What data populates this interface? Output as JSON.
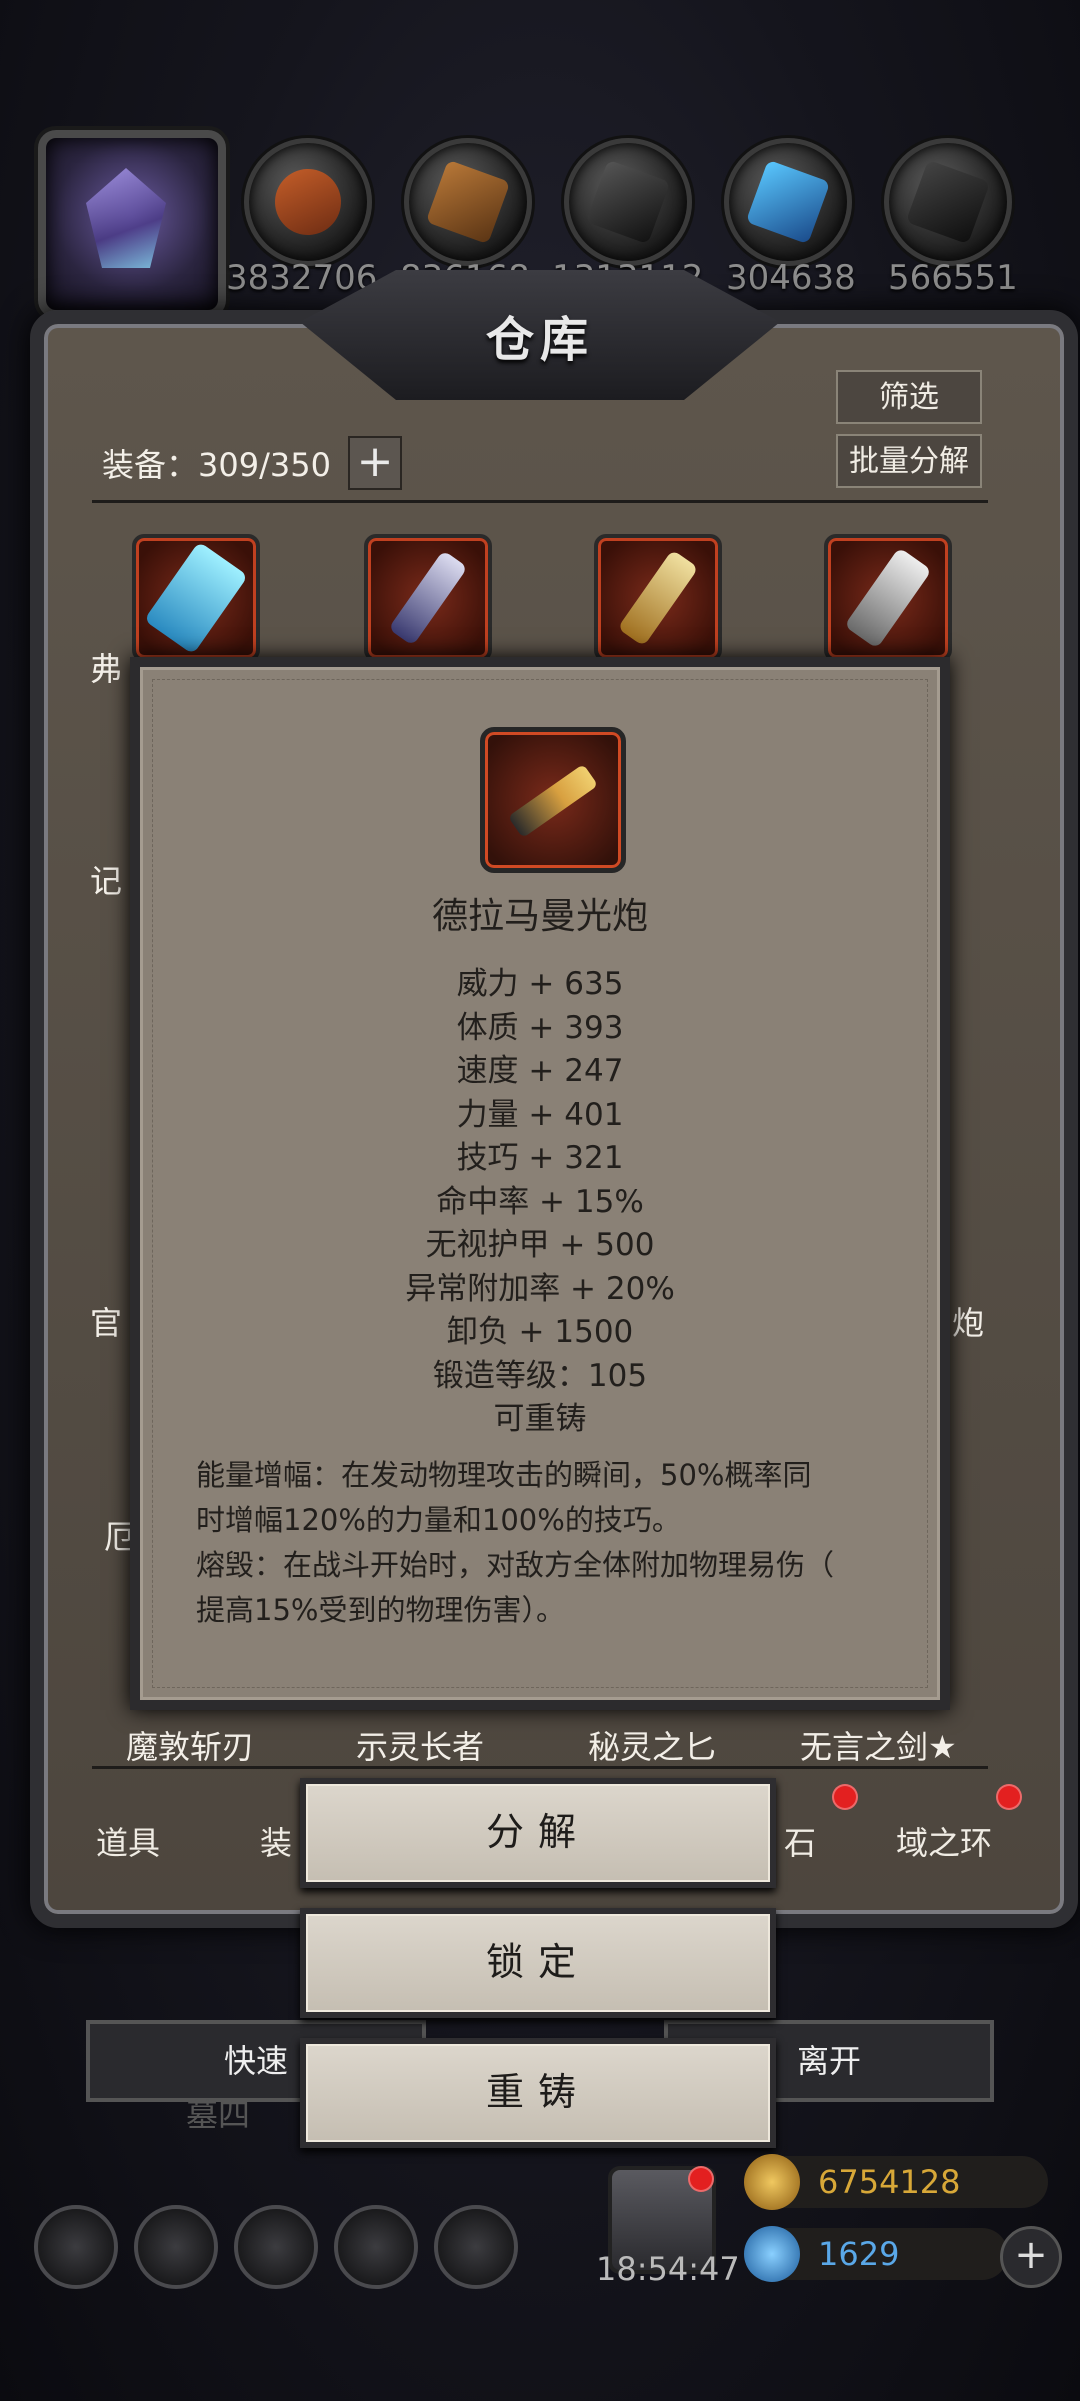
{
  "resources": {
    "values": [
      "3832706",
      "836168",
      "1313112",
      "304638",
      "566551"
    ],
    "icons": [
      "meat-resource-icon",
      "wood-resource-icon",
      "iron-resource-icon",
      "crystal-resource-icon",
      "stone-resource-icon"
    ]
  },
  "warehouse": {
    "title": "仓库",
    "filter_label": "筛选",
    "batch_decompose_label": "批量分解",
    "equip_count": "装备：309/350",
    "plus_label": "+"
  },
  "grid_partial_names": {
    "row1": [
      "弗",
      "",
      "",
      ""
    ],
    "row2_left": "记",
    "row3_left": "官",
    "row3_right": "炮",
    "row4_left": "厄",
    "row5": [
      "魔敦斩刃",
      "示灵长者",
      "秘灵之匕",
      "无言之剑★"
    ]
  },
  "tooltip": {
    "item_name": "德拉马曼光炮",
    "stats": [
      "威力 + 635",
      "体质 + 393",
      "速度 + 247",
      "力量 + 401",
      "技巧 + 321",
      "命中率 + 15%",
      "无视护甲 + 500",
      "异常附加率 + 20%",
      "卸负 + 1500",
      "锻造等级：105",
      "可重铸"
    ],
    "desc_lines": [
      "能量增幅：在发动物理攻击的瞬间，50%概率同",
      "时增幅120%的力量和100%的技巧。",
      "熔毁：在战斗开始时，对敌方全体附加物理易伤（",
      "提高15%受到的物理伤害）。"
    ]
  },
  "actions": {
    "decompose": "分解",
    "lock": "锁定",
    "reforge": "重铸"
  },
  "tabs": {
    "items": "道具",
    "equip": "装",
    "gems": "石",
    "ring": "域之环"
  },
  "bottom_buttons": {
    "quick": "快速",
    "leave": "离开",
    "sub": "墓四"
  },
  "footer": {
    "time": "18:54:47",
    "gold": "6754128",
    "gems": "1629"
  },
  "colors": {
    "panel_bg": "#8a8176",
    "frame_bg": "#5e564c",
    "button_bg": "#dcd6cc",
    "badge_red": "#e32020"
  }
}
